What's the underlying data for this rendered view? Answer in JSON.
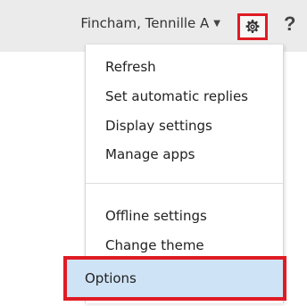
{
  "header": {
    "user_name": "Fincham, Tennille A",
    "caret": "▼",
    "help_label": "?"
  },
  "icons": {
    "gear": "gear-icon",
    "caret": "chevron-down-icon",
    "help": "help-icon"
  },
  "menu": {
    "items": [
      {
        "label": "Refresh"
      },
      {
        "label": "Set automatic replies"
      },
      {
        "label": "Display settings"
      },
      {
        "label": "Manage apps"
      },
      {
        "label": "Offline settings"
      },
      {
        "label": "Change theme"
      },
      {
        "label": "Options"
      }
    ]
  },
  "colors": {
    "highlight_border": "#e01b24",
    "selected_background": "#cfe3f6",
    "header_background": "#ebebeb"
  }
}
